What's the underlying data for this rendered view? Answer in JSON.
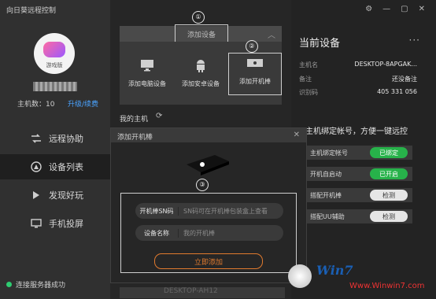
{
  "app": {
    "title": "向日葵远程控制"
  },
  "sidebar": {
    "avatar_label": "游戏版",
    "host_count": "主机数：10",
    "renew": "升级/续费",
    "items": [
      {
        "label": "远程协助",
        "icon": "remote-assist-icon"
      },
      {
        "label": "设备列表",
        "icon": "device-list-icon"
      },
      {
        "label": "发现好玩",
        "icon": "discover-icon"
      },
      {
        "label": "手机投屏",
        "icon": "phone-cast-icon"
      }
    ],
    "status": "连接服务器成功",
    "status_color": "#2ecc71"
  },
  "main": {
    "add_device": "添加设备",
    "options": [
      {
        "label": "添加电脑设备",
        "icon": "monitor-icon"
      },
      {
        "label": "添加安卓设备",
        "icon": "android-icon"
      },
      {
        "label": "添加开机棒",
        "icon": "power-stick-icon"
      }
    ],
    "my_hosts": "我的主机",
    "peek_row": "DESKTOP-AH12"
  },
  "dialog": {
    "title": "添加开机棒",
    "sn_label": "开机棒SN码",
    "sn_placeholder": "SN码可在开机棒包装盒上查看",
    "name_label": "设备名称",
    "name_placeholder": "我的开机棒",
    "submit": "立即添加",
    "accent": "#e07a2e"
  },
  "markers": [
    "①",
    "②",
    "③"
  ],
  "current": {
    "title": "当前设备",
    "host_key": "主机名",
    "host_val": "DESKTOP-8APGAK...",
    "note_key": "备注",
    "note_val": "还没备注",
    "code_key": "识别码",
    "code_val": "405 331 056",
    "bind_title": "主机绑定帐号，方便一键远控",
    "rows": [
      {
        "k": "主机绑定帐号",
        "v": "已绑定"
      },
      {
        "k": "开机自启动",
        "v": "已开启"
      },
      {
        "k": "搭配开机棒",
        "v": "检测"
      },
      {
        "k": "搭配UU辅助",
        "v": "检测"
      }
    ],
    "green": "#27b24a"
  },
  "watermark": {
    "brand": "Win7",
    "url": "Www.Winwin7.com"
  }
}
